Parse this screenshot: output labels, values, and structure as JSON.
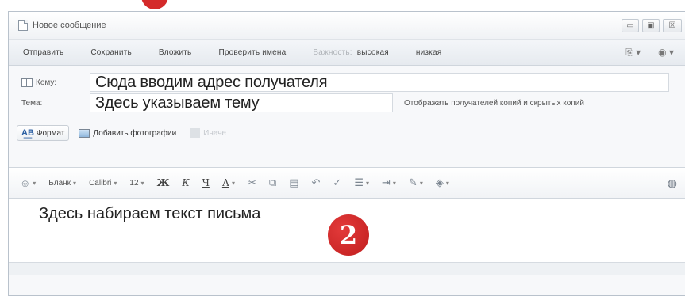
{
  "window": {
    "title": "Новое сообщение",
    "controls": {
      "minimize": "▭",
      "maximize": "▣",
      "close": "☒"
    }
  },
  "commands": {
    "send": "Отправить",
    "save": "Сохранить",
    "attach": "Вложить",
    "check_names": "Проверить имена",
    "importance": "Важность:",
    "high": "высокая",
    "low": "низкая",
    "right_icons": [
      "encoding-icon",
      "help-icon"
    ]
  },
  "fields": {
    "to_label": "Кому:",
    "to_value": "Сюда вводим адрес получателя",
    "subject_label": "Тема:",
    "subject_value": "Здесь указываем тему",
    "cc_link": "Отображать получателей копий и скрытых копий"
  },
  "format_row": {
    "format_button": "Формат",
    "add_photos": "Добавить фотографии",
    "greyed": "Иначе"
  },
  "toolbar": {
    "stationery": "Бланк",
    "font": "Calibri",
    "size": "12",
    "bold": "Ж",
    "italic": "К",
    "underline": "Ч",
    "font_color": "А"
  },
  "body": {
    "text": "Здесь набираем текст письма",
    "badge": "2"
  },
  "colors": {
    "badge": "#d42a2a",
    "window_border": "#b9c2cc"
  }
}
